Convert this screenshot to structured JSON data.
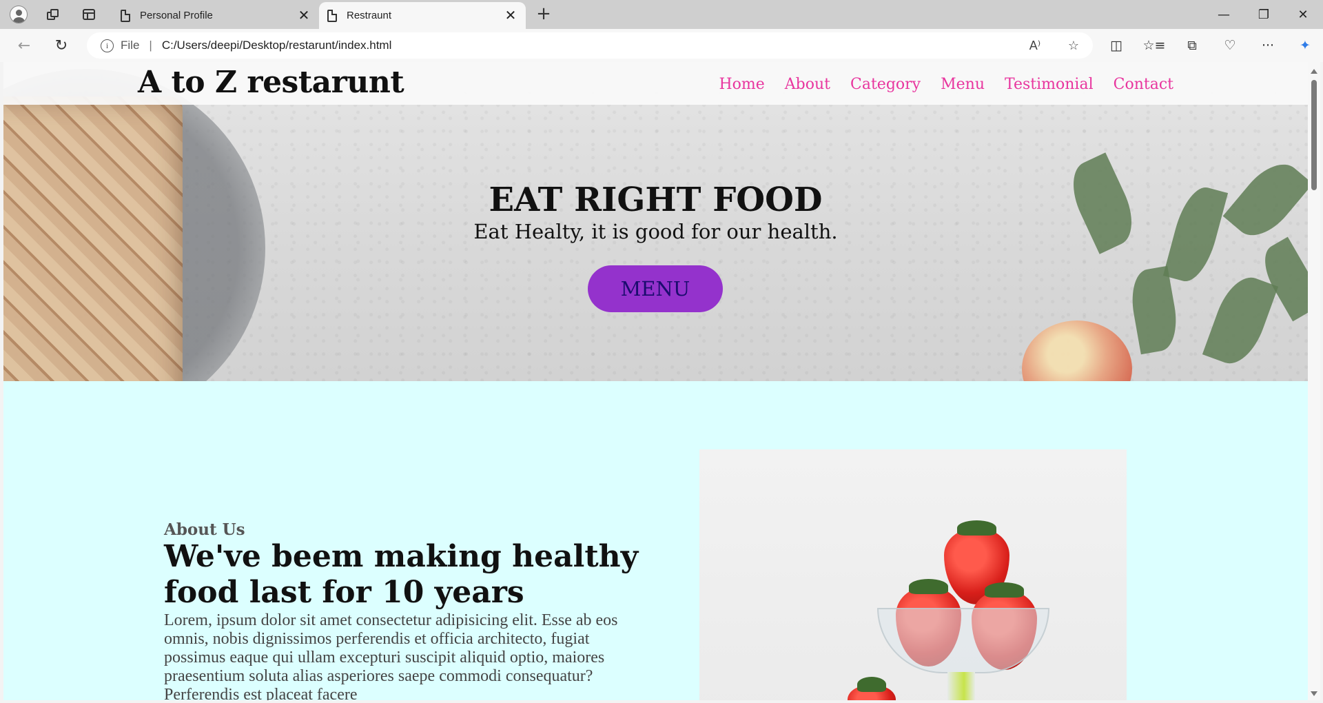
{
  "browser": {
    "tabs": [
      {
        "title": "Personal Profile",
        "active": false
      },
      {
        "title": "Restraunt",
        "active": true
      }
    ],
    "address": {
      "scheme_label": "File",
      "url": "C:/Users/deepi/Desktop/restarunt/index.html"
    },
    "icons": {
      "close_glyph": "✕",
      "new_tab_glyph": "+",
      "minimize_glyph": "—",
      "maximize_glyph": "❐",
      "window_close_glyph": "✕",
      "back_glyph": "←",
      "reload_glyph": "↻",
      "info_glyph": "i",
      "read_aloud_glyph": "A⁾",
      "favorite_glyph": "☆",
      "split_glyph": "◫",
      "favorites_glyph": "☆≡",
      "collections_glyph": "⧉",
      "health_glyph": "♡",
      "more_glyph": "···",
      "copilot_glyph": "✦"
    }
  },
  "site": {
    "logo": "A to Z restarunt",
    "nav": [
      "Home",
      "About",
      "Category",
      "Menu",
      "Testimonial",
      "Contact"
    ],
    "colors": {
      "nav": "#e8359e",
      "button": "#9432cc",
      "section_bg": "#dcffff"
    }
  },
  "hero": {
    "title": "EAT RIGHT FOOD",
    "subtitle": "Eat Healty, it is good for our health.",
    "button": "MENU"
  },
  "about": {
    "label": "About Us",
    "heading": "We've beem making healthy food last for 10 years",
    "text": "Lorem, ipsum dolor sit amet consectetur adipisicing elit. Esse ab eos omnis, nobis dignissimos perferendis et officia architecto, fugiat possimus eaque qui ullam excepturi suscipit aliquid optio, maiores praesentium soluta alias asperiores saepe commodi consequatur? Perferendis est placeat facere"
  }
}
